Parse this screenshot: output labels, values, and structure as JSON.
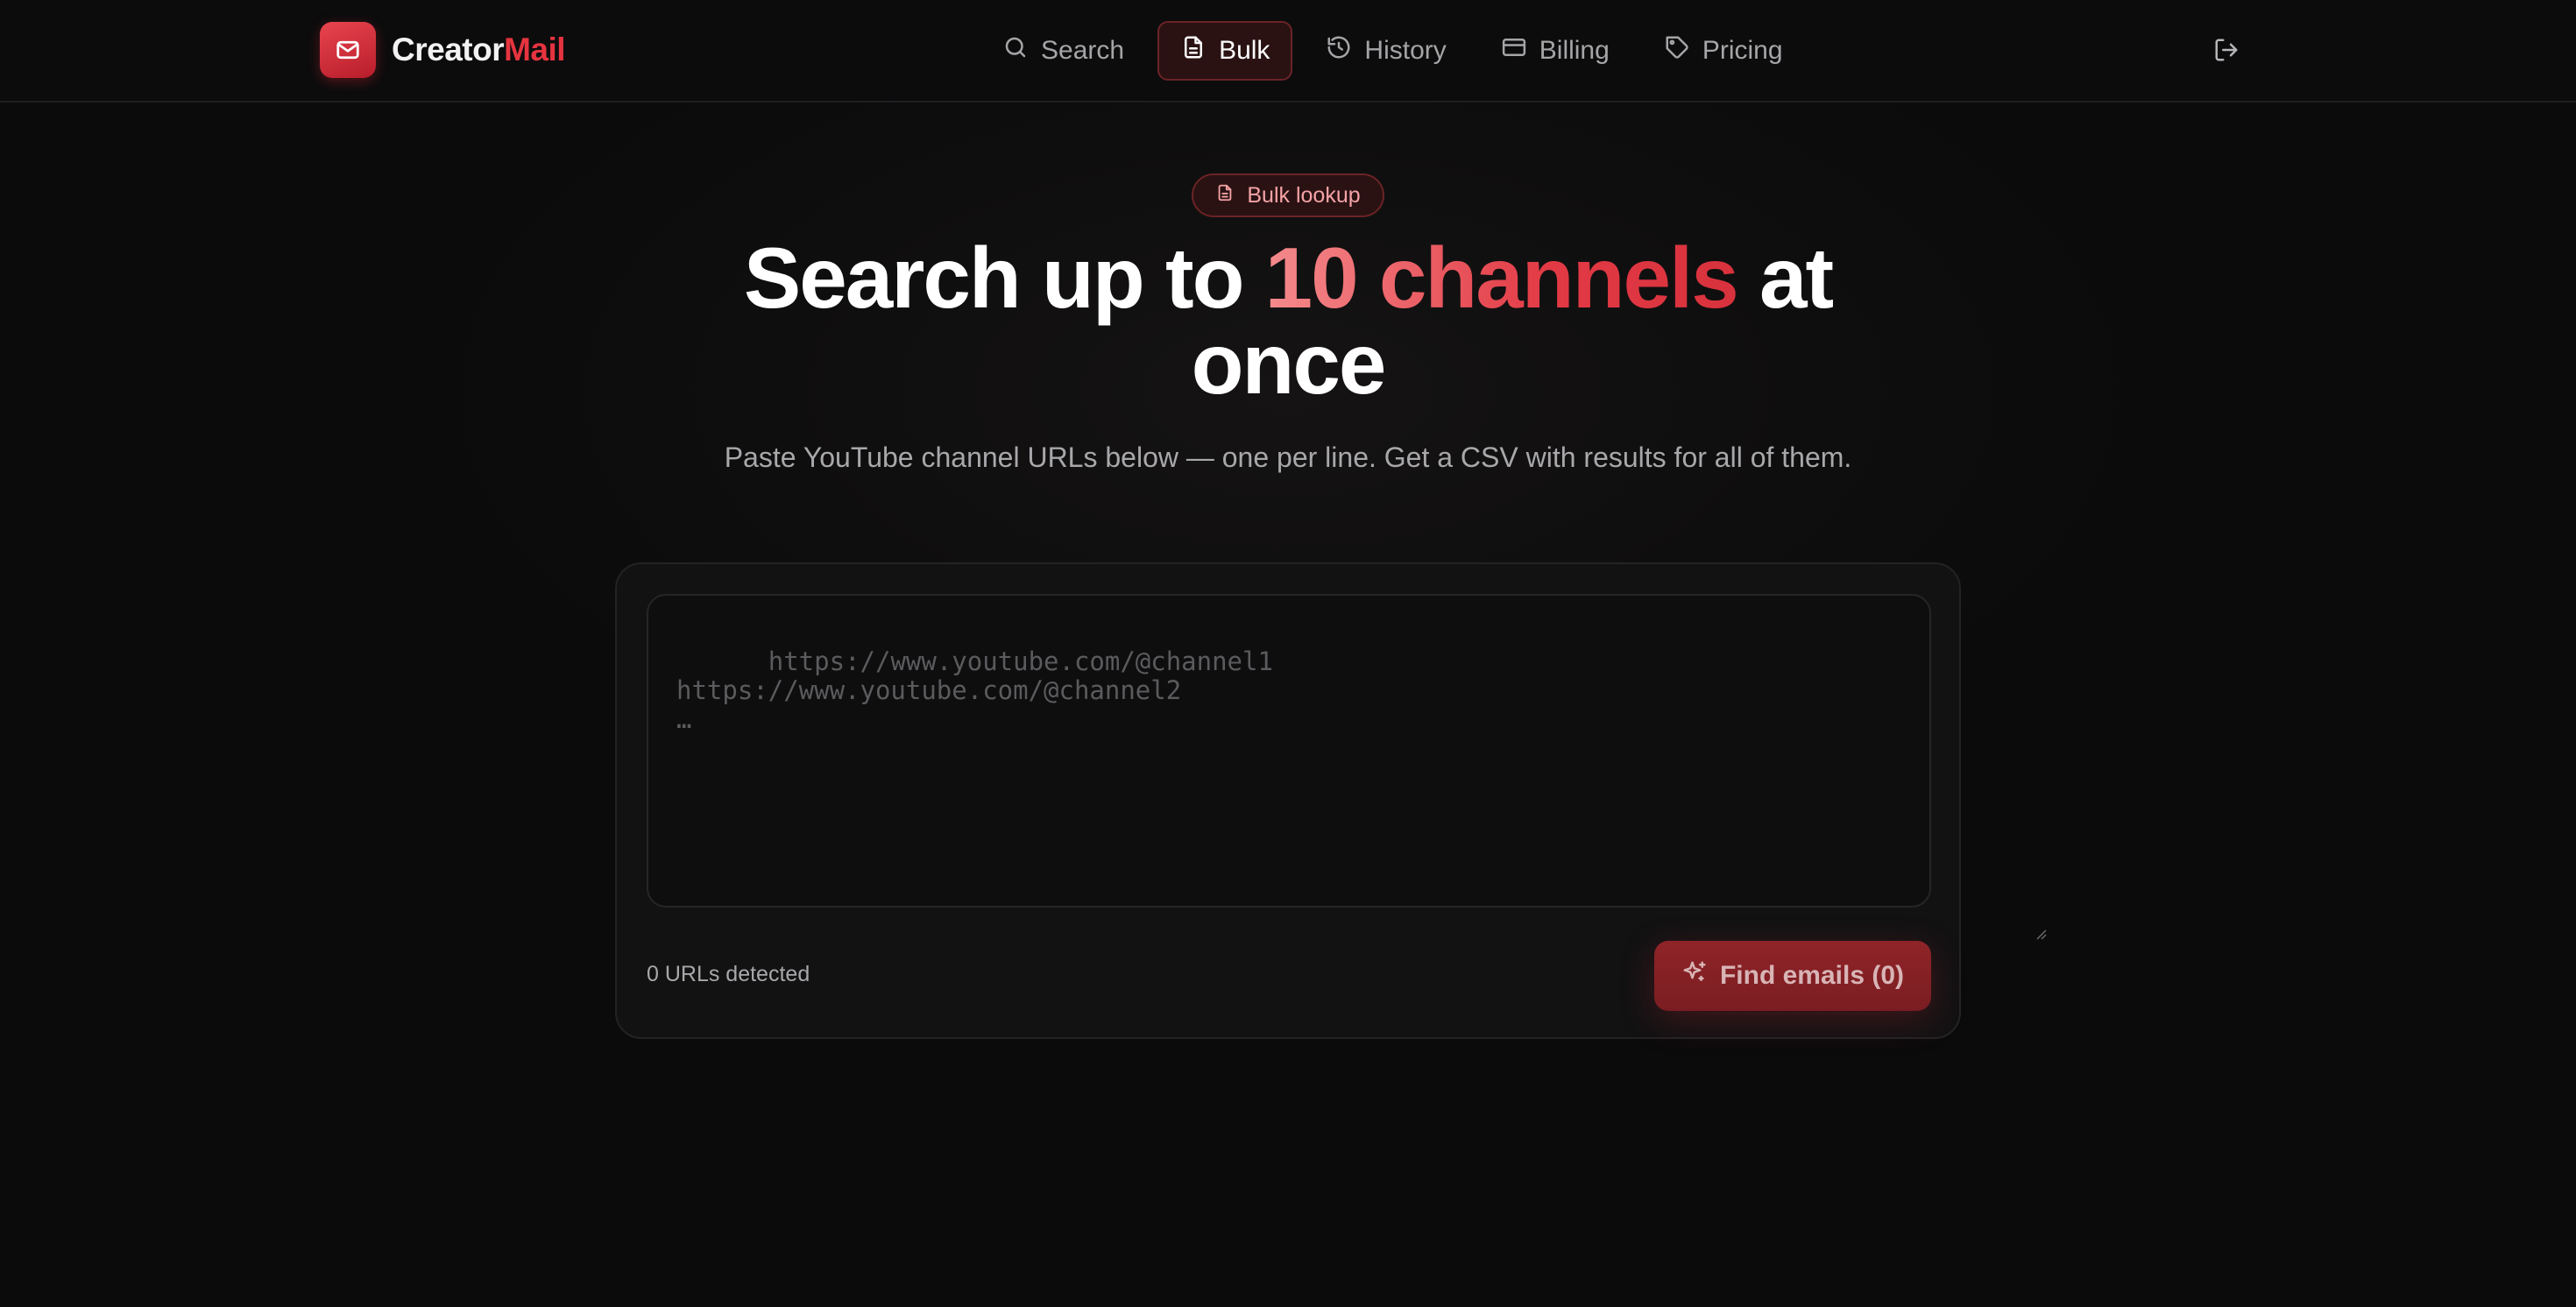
{
  "header": {
    "logo": {
      "part1": "Creator",
      "part2": "Mail"
    },
    "nav": [
      {
        "label": "Search",
        "icon": "search-icon"
      },
      {
        "label": "Bulk",
        "icon": "document-icon",
        "active": true
      },
      {
        "label": "History",
        "icon": "history-icon"
      },
      {
        "label": "Billing",
        "icon": "credit-card-icon"
      },
      {
        "label": "Pricing",
        "icon": "tag-icon"
      }
    ],
    "logout_icon": "logout-icon"
  },
  "hero": {
    "badge": "Bulk lookup",
    "title_part1": "Search up to ",
    "title_highlight": "10 channels",
    "title_part2": " at once",
    "subtitle": "Paste YouTube channel URLs below — one per line. Get a CSV with results for all of them."
  },
  "form": {
    "placeholder": "https://www.youtube.com/@channel1\nhttps://www.youtube.com/@channel2\n…",
    "value": "",
    "url_count": "0 URLs detected",
    "button_label": "Find emails (0)"
  },
  "colors": {
    "accent": "#e5343f",
    "background": "#0b0b0c",
    "active_nav_bg": "#2a1213"
  }
}
